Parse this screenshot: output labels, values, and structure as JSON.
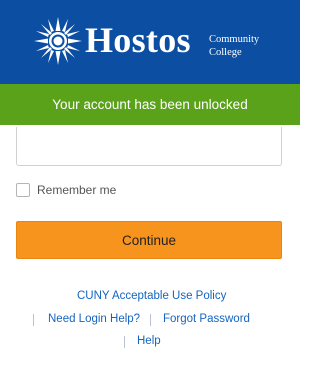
{
  "header": {
    "brand_name": "Hostos",
    "brand_sub_line1": "Community",
    "brand_sub_line2": "College",
    "background_color": "#0b4ea2",
    "logo_icon": "sun-icon"
  },
  "banner": {
    "message": "Your account has been unlocked",
    "background_color": "#5ba21b"
  },
  "form": {
    "username_value": "",
    "remember_me_label": "Remember me",
    "remember_me_checked": false,
    "continue_label": "Continue",
    "continue_color": "#f7941d"
  },
  "links": {
    "acceptable_use": "CUNY Acceptable Use Policy",
    "login_help": "Need Login Help?",
    "forgot_password": "Forgot Password",
    "help": "Help"
  }
}
